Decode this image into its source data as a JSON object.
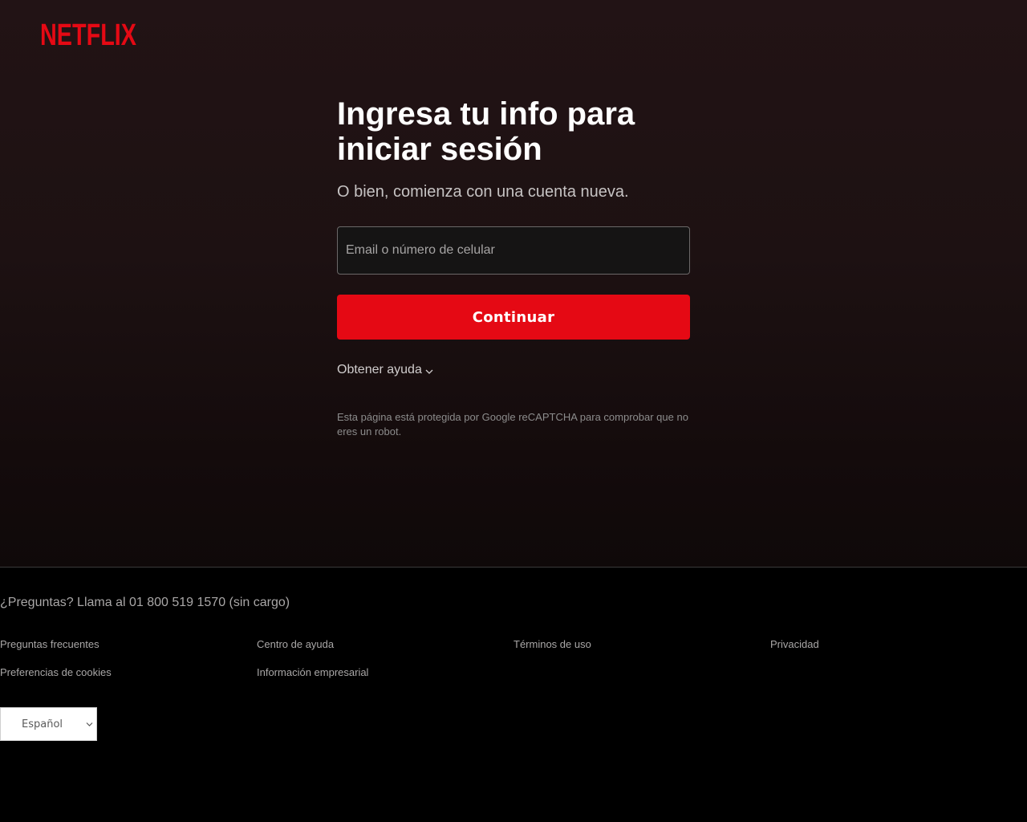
{
  "brand": {
    "logo_text": "NETFLIX",
    "accent_color": "#e50914"
  },
  "login": {
    "title": "Ingresa tu info para iniciar sesión",
    "subtitle": "O bien, comienza con una cuenta nueva.",
    "email_placeholder": "Email o número de celular",
    "email_value": "",
    "continue_label": "Continuar",
    "help_label": "Obtener ayuda",
    "help_icon": "chevron-down-icon",
    "recaptcha_notice": "Esta página está protegida por Google reCAPTCHA para comprobar que no eres un robot."
  },
  "footer": {
    "phone_text": "¿Preguntas? Llama al 01 800 519 1570 (sin cargo)",
    "links": [
      "Preguntas frecuentes",
      "Centro de ayuda",
      "Términos de uso",
      "Privacidad",
      "Preferencias de cookies",
      "Información empresarial"
    ],
    "language": {
      "selected": "Español",
      "icon": "chevron-down-icon"
    }
  }
}
